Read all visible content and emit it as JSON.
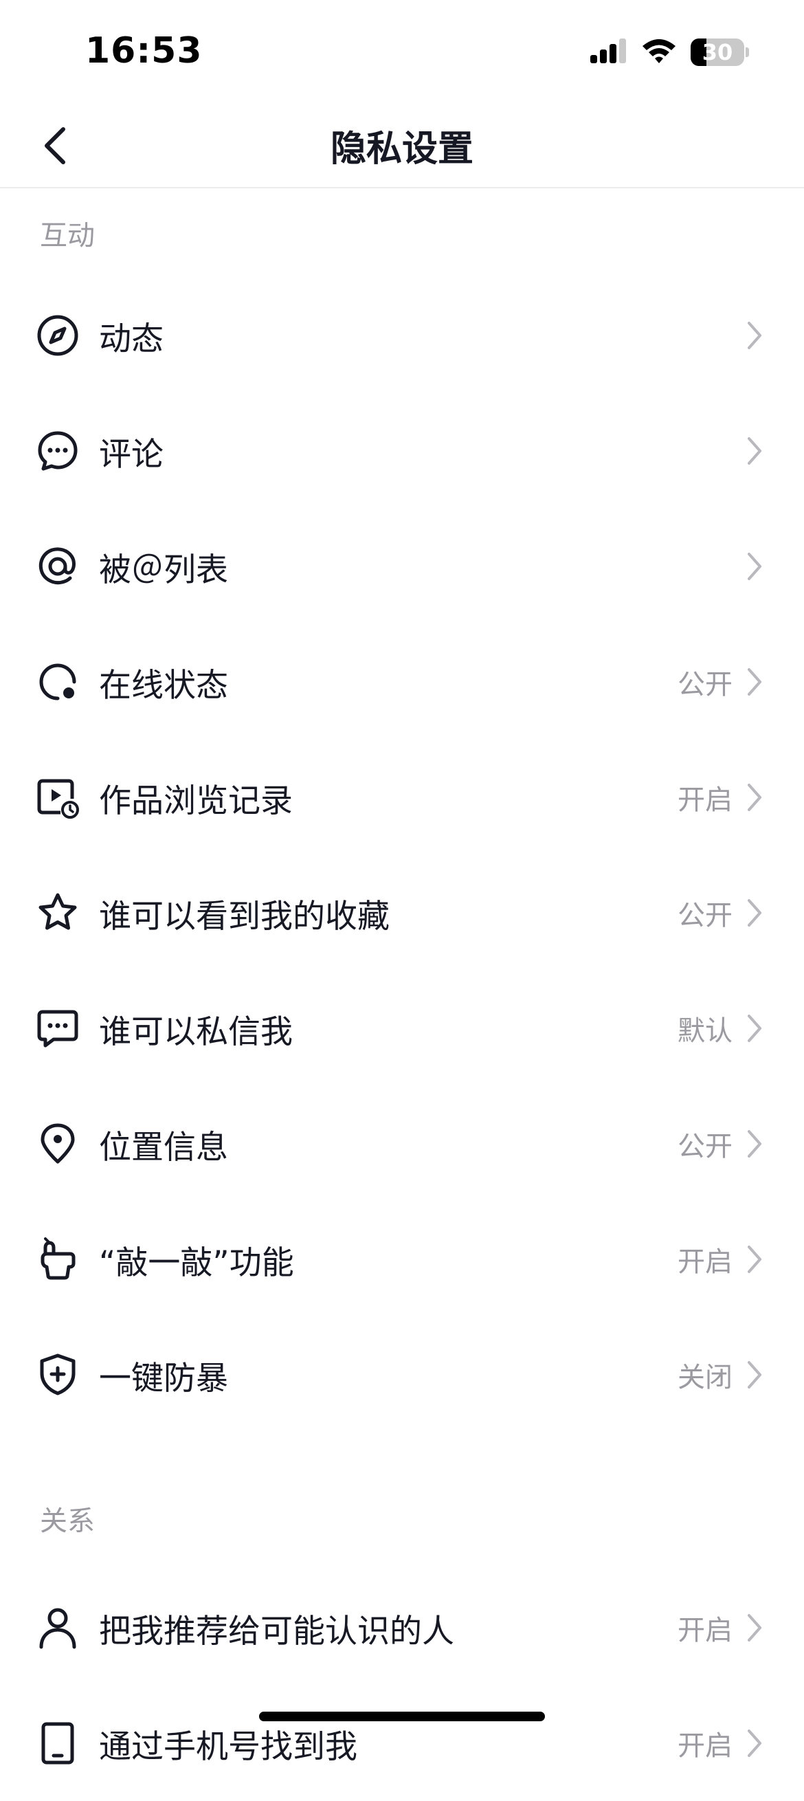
{
  "status_bar": {
    "time": "16:53",
    "battery_level": "30",
    "battery_fraction": 0.3,
    "signal_icon": "signal-icon",
    "wifi_icon": "wifi-icon"
  },
  "nav": {
    "title": "隐私设置",
    "back_icon": "chevron-left-icon"
  },
  "sections": {
    "interaction": {
      "header": "互动",
      "items": [
        {
          "label": "动态",
          "value": "",
          "icon": "compass-icon"
        },
        {
          "label": "评论",
          "value": "",
          "icon": "comment-bubble-icon"
        },
        {
          "label": "被＠列表",
          "value": "",
          "icon": "at-sign-icon"
        },
        {
          "label": "在线状态",
          "value": "公开",
          "icon": "online-status-icon"
        },
        {
          "label": "作品浏览记录",
          "value": "开启",
          "icon": "video-history-icon"
        },
        {
          "label": "谁可以看到我的收藏",
          "value": "公开",
          "icon": "star-icon"
        },
        {
          "label": "谁可以私信我",
          "value": "默认",
          "icon": "message-icon"
        },
        {
          "label": "位置信息",
          "value": "公开",
          "icon": "location-pin-icon"
        },
        {
          "label": "“敲一敲”功能",
          "value": "开启",
          "icon": "knock-icon"
        },
        {
          "label": "一键防暴",
          "value": "关闭",
          "icon": "shield-plus-icon"
        }
      ]
    },
    "relations": {
      "header": "关系",
      "items": [
        {
          "label": "把我推荐给可能认识的人",
          "value": "开启",
          "icon": "person-icon"
        },
        {
          "label": "通过手机号找到我",
          "value": "开启",
          "icon": "phone-icon"
        }
      ]
    }
  },
  "colors": {
    "text_primary": "#161823",
    "text_secondary": "#9a9aa0",
    "chevron": "#b8b8bd",
    "divider": "#ececec"
  }
}
